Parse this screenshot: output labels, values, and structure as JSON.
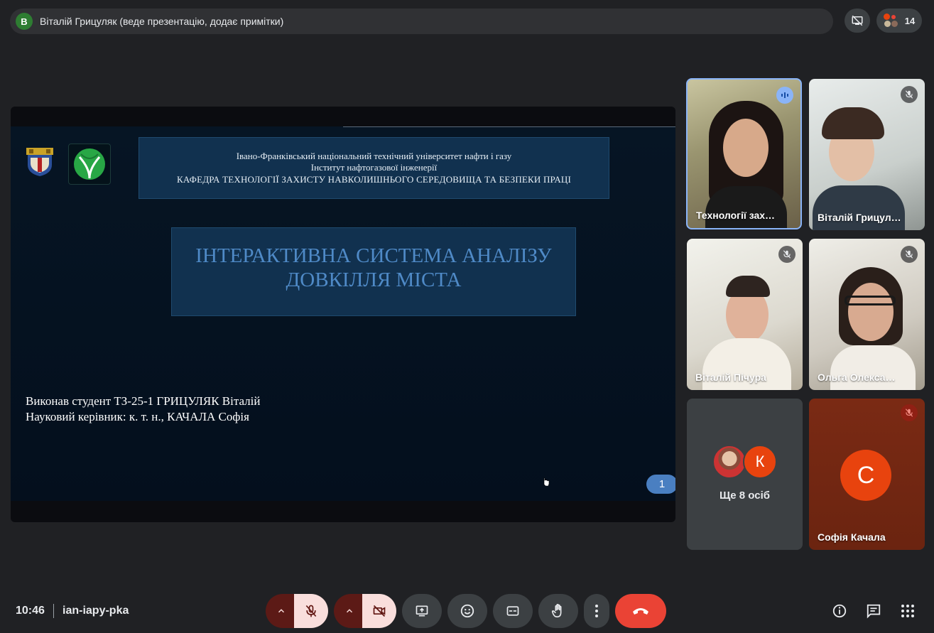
{
  "presenter": {
    "initial": "В",
    "text": "Віталій Грицуляк (веде презентацію, додає примітки)"
  },
  "participants_count": "14",
  "slide": {
    "header_line1": "Івано-Франківський національний  технічний університет нафти і газу",
    "header_line2": "Інститут нафтогазової інженерії",
    "header_line3": "КАФЕДРА  ТЕХНОЛОГІЇ ЗАХИСТУ  НАВКОЛИШНЬОГО СЕРЕДОВИЩА ТА БЕЗПЕКИ ПРАЦІ",
    "title_line1": "ІНТЕРАКТИВНА СИСТЕМА АНАЛІЗУ",
    "title_line2": "ДОВКІЛЛЯ МІСТА",
    "credit_line1": "Виконав студент ТЗ-25-1 ГРИЦУЛЯК Віталій",
    "credit_line2": "Науковий керівник: к. т. н., КАЧАЛА Софія",
    "page_number": "1"
  },
  "tiles": [
    {
      "name": "Технології зах…",
      "state": "speaking"
    },
    {
      "name": "Віталій Грицул…",
      "state": "muted"
    },
    {
      "name": "Віталій Пічура",
      "state": "muted"
    },
    {
      "name": "Ольга Олекса…",
      "state": "muted"
    }
  ],
  "more_tile": {
    "avatar_initial": "К",
    "label": "Ще 8 осіб"
  },
  "sofia_tile": {
    "initial": "С",
    "name": "Софія Качала"
  },
  "bottom": {
    "time": "10:46",
    "meeting_code": "ian-iapy-pka"
  },
  "colors": {
    "background": "#202124",
    "accent_blue": "#8ab4f8",
    "hangup_red": "#ea4335",
    "muted_toggle": "#f9dedc"
  }
}
